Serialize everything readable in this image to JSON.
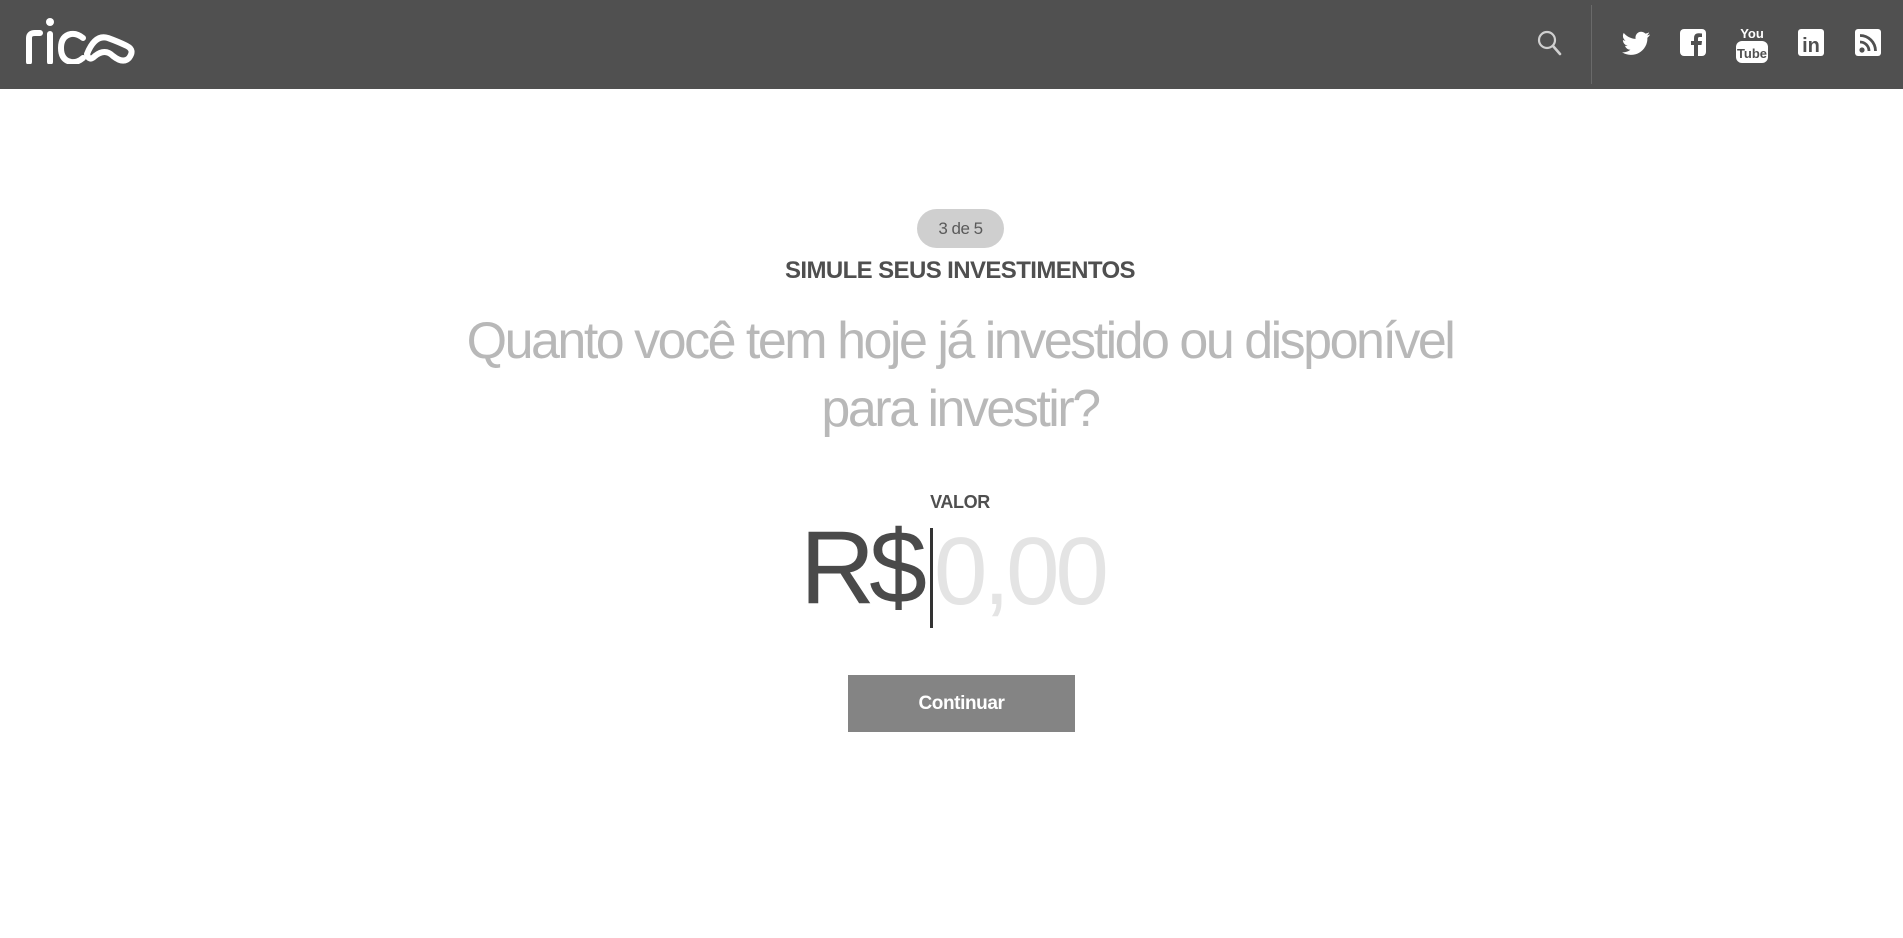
{
  "header": {
    "logo_text": "rico",
    "icons": {
      "search": "search-icon",
      "twitter": "twitter-icon",
      "facebook": "facebook-icon",
      "youtube": "youtube-icon",
      "linkedin": "linkedin-icon",
      "rss": "rss-icon"
    },
    "youtube_top": "You",
    "youtube_bottom": "Tube",
    "linkedin_text": "in"
  },
  "step": {
    "label": "3 de 5"
  },
  "main": {
    "kicker": "SIMULE SEUS INVESTIMENTOS",
    "question": "Quanto você tem hoje já investido ou disponível para investir?",
    "value_label": "VALOR",
    "currency": "R$",
    "amount_placeholder": "0,00",
    "amount_value": "",
    "continue_label": "Continuar"
  },
  "colors": {
    "header_bg": "#505050",
    "button_bg": "#848484",
    "badge_bg": "#cfcfcf"
  }
}
